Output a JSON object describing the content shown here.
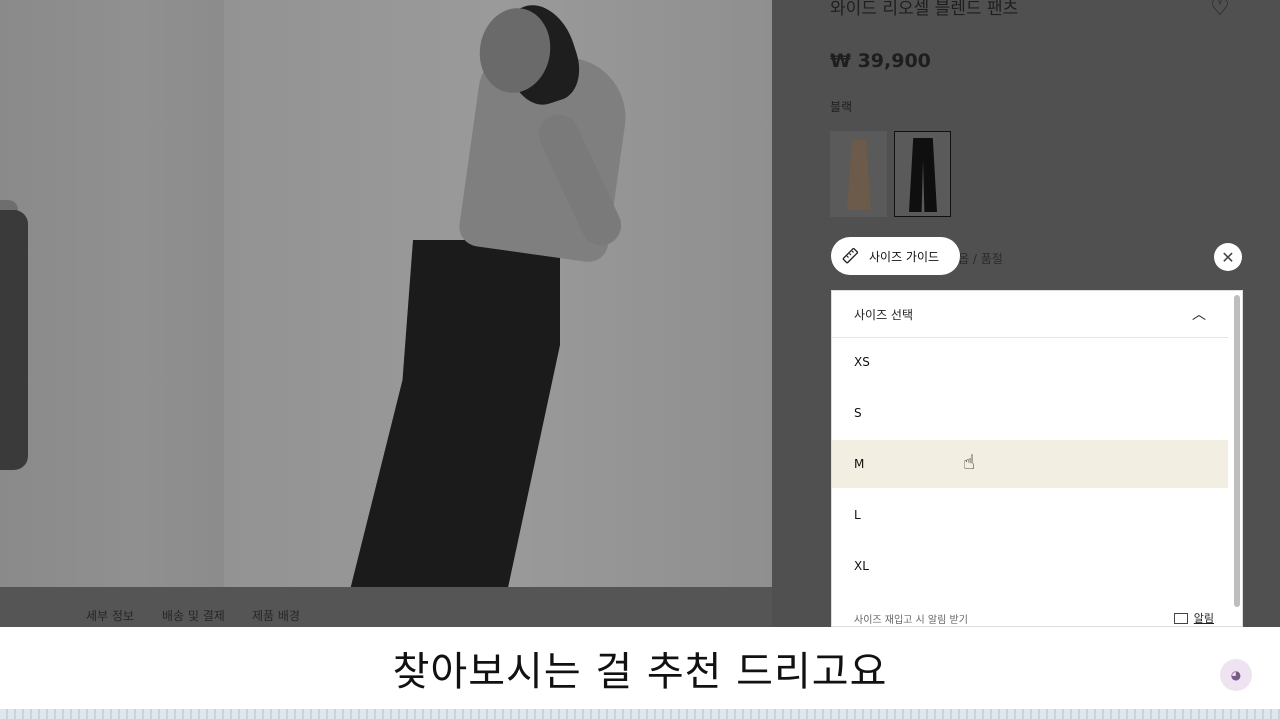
{
  "product": {
    "title": "와이드 리오셀 블렌드 팬츠",
    "price": "₩ 39,900",
    "color_label": "블랙",
    "behind_text": "옵 / 품절",
    "size_guide_label": "사이즈 가이드"
  },
  "dropdown": {
    "header_label": "사이즈 선택",
    "options": [
      "XS",
      "S",
      "M",
      "L",
      "XL"
    ],
    "hovered": "M",
    "footer_text": "사이즈 재입고 시 알림 받기",
    "notify_label": "알림"
  },
  "tabs": [
    "세부 정보",
    "배송 및 결제",
    "제품 배경"
  ],
  "subtitle": "찾아보시는 걸 추천 드리고요",
  "icons": {
    "favorite": "heart-icon",
    "size_guide": "ruler-icon",
    "close": "close-icon",
    "collapse": "chevron-up-icon",
    "notify": "mail-icon",
    "cursor": "hand-cursor-icon"
  }
}
